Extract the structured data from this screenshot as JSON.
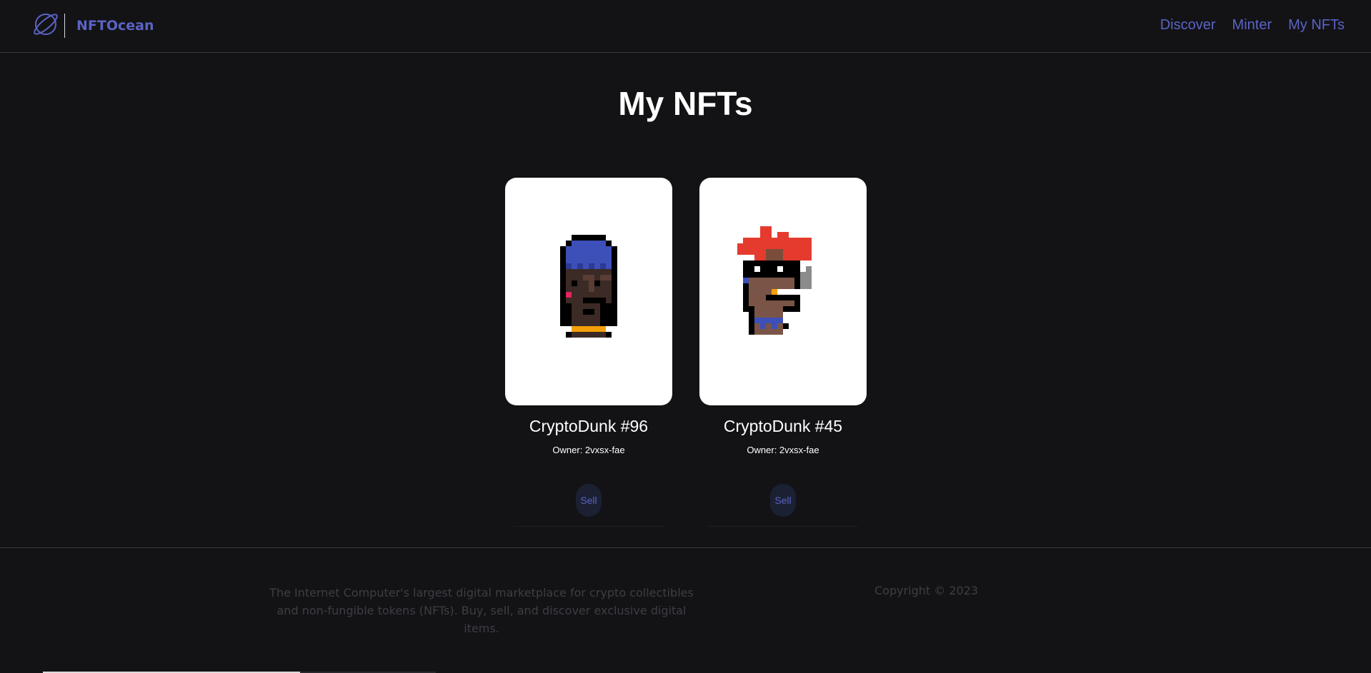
{
  "header": {
    "brand": "NFTOcean",
    "nav": [
      {
        "label": "Discover"
      },
      {
        "label": "Minter"
      },
      {
        "label": "My NFTs"
      }
    ]
  },
  "page": {
    "title": "My NFTs"
  },
  "nfts": [
    {
      "name": "CryptoDunk #96",
      "owner": "Owner: 2vxsx-fae",
      "sell_label": "Sell",
      "image": "pixel-avatar-blue-beanie"
    },
    {
      "name": "CryptoDunk #45",
      "owner": "Owner: 2vxsx-fae",
      "sell_label": "Sell",
      "image": "pixel-avatar-red-hair"
    }
  ],
  "footer": {
    "description": "The Internet Computer's largest digital marketplace for crypto collectibles and non-fungible tokens (NFTs). Buy, sell, and discover exclusive digital items.",
    "copyright": "Copyright © 2023"
  },
  "colors": {
    "background": "#131316",
    "accent": "#5b63c4",
    "card": "#ffffff",
    "sell_bg": "#1c2033"
  }
}
